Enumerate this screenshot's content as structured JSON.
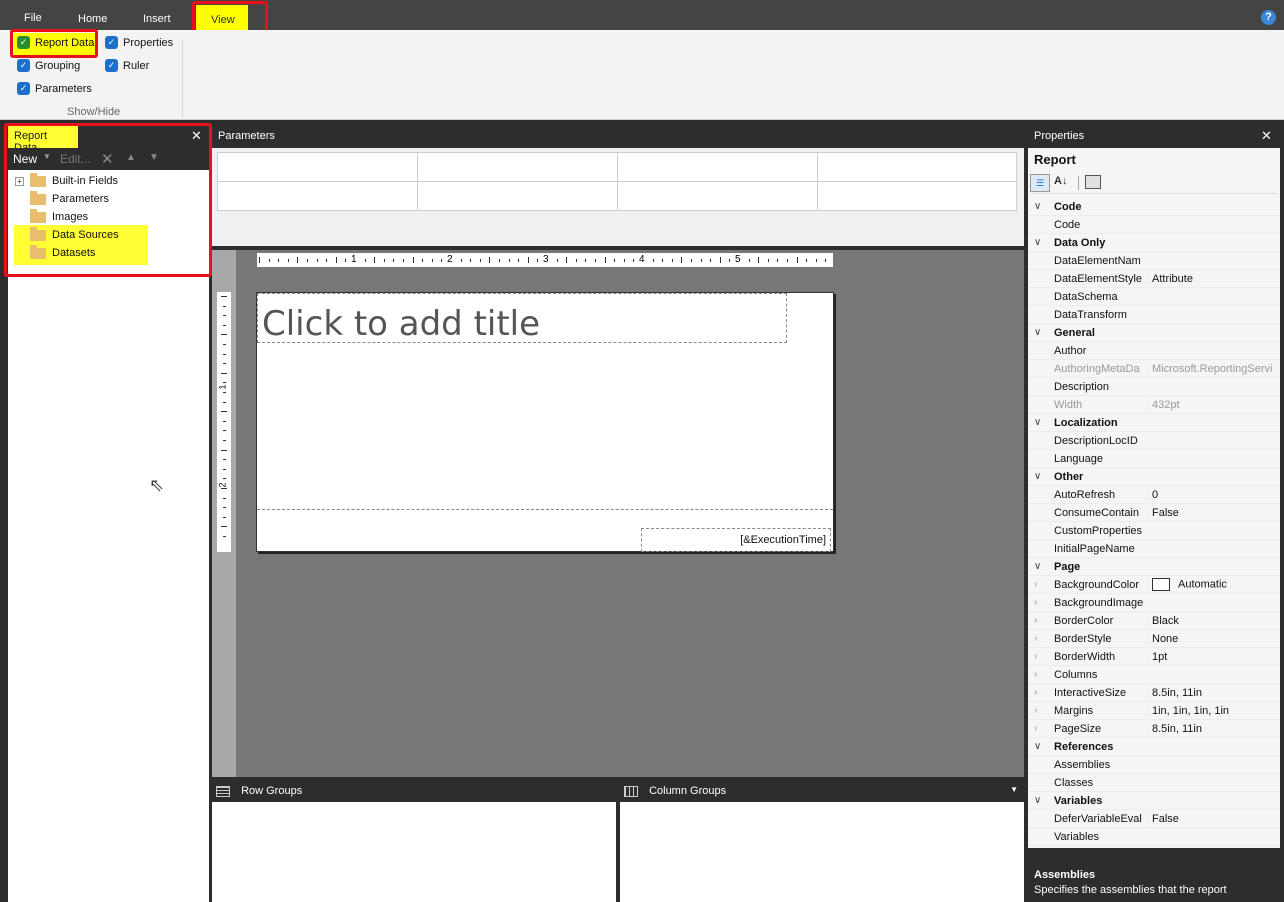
{
  "ribbon": {
    "tabs": [
      "File",
      "Home",
      "Insert",
      "View"
    ],
    "help": "?",
    "checkboxes": [
      {
        "label": "Report Data",
        "checked": true
      },
      {
        "label": "Properties",
        "checked": true
      },
      {
        "label": "Grouping",
        "checked": true
      },
      {
        "label": "Ruler",
        "checked": true
      },
      {
        "label": "Parameters",
        "checked": true
      }
    ],
    "group_label": "Show/Hide"
  },
  "report_data": {
    "title": "Report Data",
    "new_label": "New",
    "edit_label": "Edit...",
    "items": [
      "Built-in Fields",
      "Parameters",
      "Images",
      "Data Sources",
      "Datasets"
    ]
  },
  "parameters_pane": {
    "title": "Parameters"
  },
  "design": {
    "title_placeholder": "Click to add title",
    "footer_text": "[&ExecutionTime]",
    "ruler_numbers": [
      "1",
      "2",
      "3",
      "4",
      "5"
    ],
    "vruler_numbers": [
      "1",
      "2"
    ]
  },
  "grouping": {
    "row_groups": "Row Groups",
    "column_groups": "Column Groups"
  },
  "properties": {
    "title": "Properties",
    "object": "Report",
    "rows": [
      {
        "type": "cat",
        "name": "Code"
      },
      {
        "type": "prop",
        "name": "Code",
        "value": ""
      },
      {
        "type": "cat",
        "name": "Data Only"
      },
      {
        "type": "prop",
        "name": "DataElementNam",
        "value": ""
      },
      {
        "type": "prop",
        "name": "DataElementStyle",
        "value": "Attribute"
      },
      {
        "type": "prop",
        "name": "DataSchema",
        "value": ""
      },
      {
        "type": "prop",
        "name": "DataTransform",
        "value": ""
      },
      {
        "type": "cat",
        "name": "General"
      },
      {
        "type": "prop",
        "name": "Author",
        "value": ""
      },
      {
        "type": "dis",
        "name": "AuthoringMetaDa",
        "value": "Microsoft.ReportingServi"
      },
      {
        "type": "prop",
        "name": "Description",
        "value": ""
      },
      {
        "type": "dis",
        "name": "Width",
        "value": "432pt"
      },
      {
        "type": "cat",
        "name": "Localization"
      },
      {
        "type": "prop",
        "name": "DescriptionLocID",
        "value": ""
      },
      {
        "type": "prop",
        "name": "Language",
        "value": ""
      },
      {
        "type": "cat",
        "name": "Other"
      },
      {
        "type": "prop",
        "name": "AutoRefresh",
        "value": "0"
      },
      {
        "type": "prop",
        "name": "ConsumeContain",
        "value": "False"
      },
      {
        "type": "prop",
        "name": "CustomProperties",
        "value": ""
      },
      {
        "type": "prop",
        "name": "InitialPageName",
        "value": ""
      },
      {
        "type": "cat",
        "name": "Page"
      },
      {
        "type": "color",
        "name": "BackgroundColor",
        "value": "Automatic"
      },
      {
        "type": "exp",
        "name": "BackgroundImage",
        "value": ""
      },
      {
        "type": "exp",
        "name": "BorderColor",
        "value": "Black"
      },
      {
        "type": "exp",
        "name": "BorderStyle",
        "value": "None"
      },
      {
        "type": "exp",
        "name": "BorderWidth",
        "value": "1pt"
      },
      {
        "type": "exp",
        "name": "Columns",
        "value": ""
      },
      {
        "type": "exp",
        "name": "InteractiveSize",
        "value": "8.5in, 11in"
      },
      {
        "type": "exp",
        "name": "Margins",
        "value": "1in, 1in, 1in, 1in"
      },
      {
        "type": "exp",
        "name": "PageSize",
        "value": "8.5in, 11in"
      },
      {
        "type": "cat",
        "name": "References"
      },
      {
        "type": "prop",
        "name": "Assemblies",
        "value": ""
      },
      {
        "type": "prop",
        "name": "Classes",
        "value": ""
      },
      {
        "type": "cat",
        "name": "Variables"
      },
      {
        "type": "prop",
        "name": "DeferVariableEval",
        "value": "False"
      },
      {
        "type": "prop",
        "name": "Variables",
        "value": ""
      }
    ],
    "desc_title": "Assemblies",
    "desc_text": "Specifies the assemblies that the report"
  }
}
